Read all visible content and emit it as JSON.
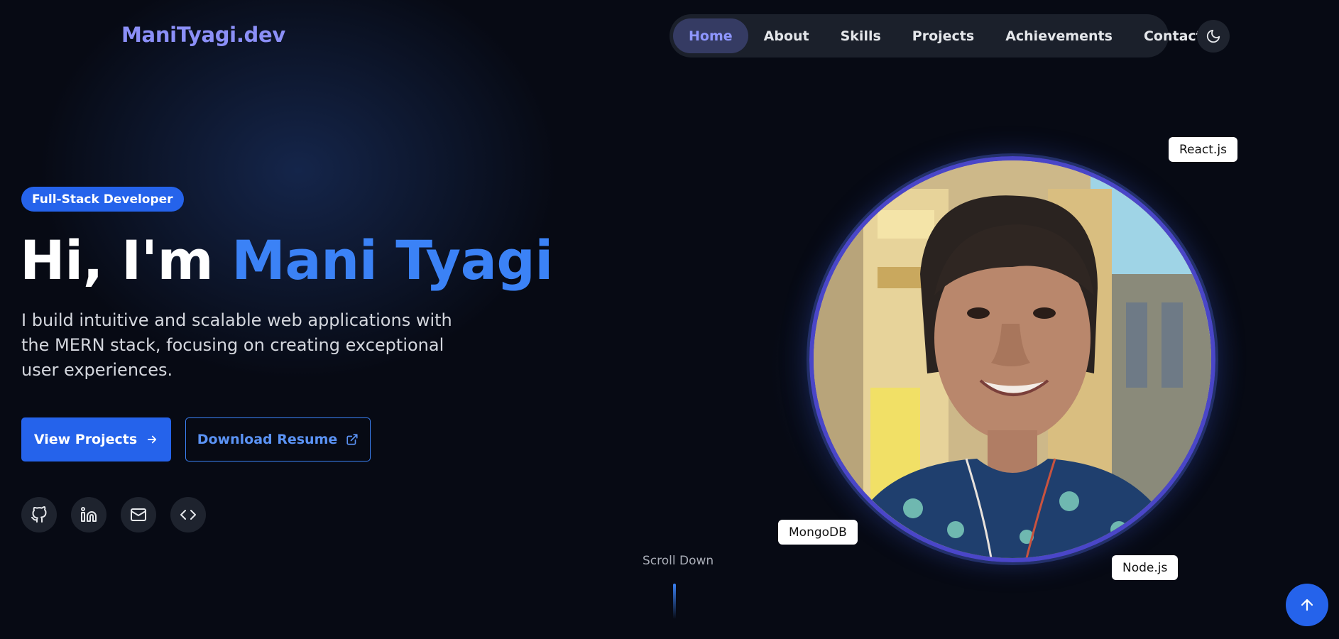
{
  "header": {
    "logo": "ManiTyagi.dev",
    "nav": [
      {
        "label": "Home",
        "active": true
      },
      {
        "label": "About"
      },
      {
        "label": "Skills"
      },
      {
        "label": "Projects"
      },
      {
        "label": "Achievements"
      },
      {
        "label": "Contact"
      }
    ],
    "theme_toggle_icon": "moon-icon"
  },
  "hero": {
    "badge": "Full-Stack Developer",
    "greeting": "Hi, I'm ",
    "name": "Mani Tyagi",
    "intro": "I build intuitive and scalable web applications with the MERN stack, focusing on creating exceptional user experiences.",
    "primary_button": "View Projects",
    "secondary_button": "Download Resume",
    "socials": [
      "github-icon",
      "linkedin-icon",
      "mail-icon",
      "code-icon"
    ]
  },
  "portrait": {
    "tags": [
      "React.js",
      "MongoDB",
      "Node.js"
    ]
  },
  "scroll": {
    "label": "Scroll Down"
  },
  "colors": {
    "accent": "#2563eb",
    "name_highlight": "#3b82f6",
    "logo": "#8b8ff7",
    "background": "#070a14"
  }
}
